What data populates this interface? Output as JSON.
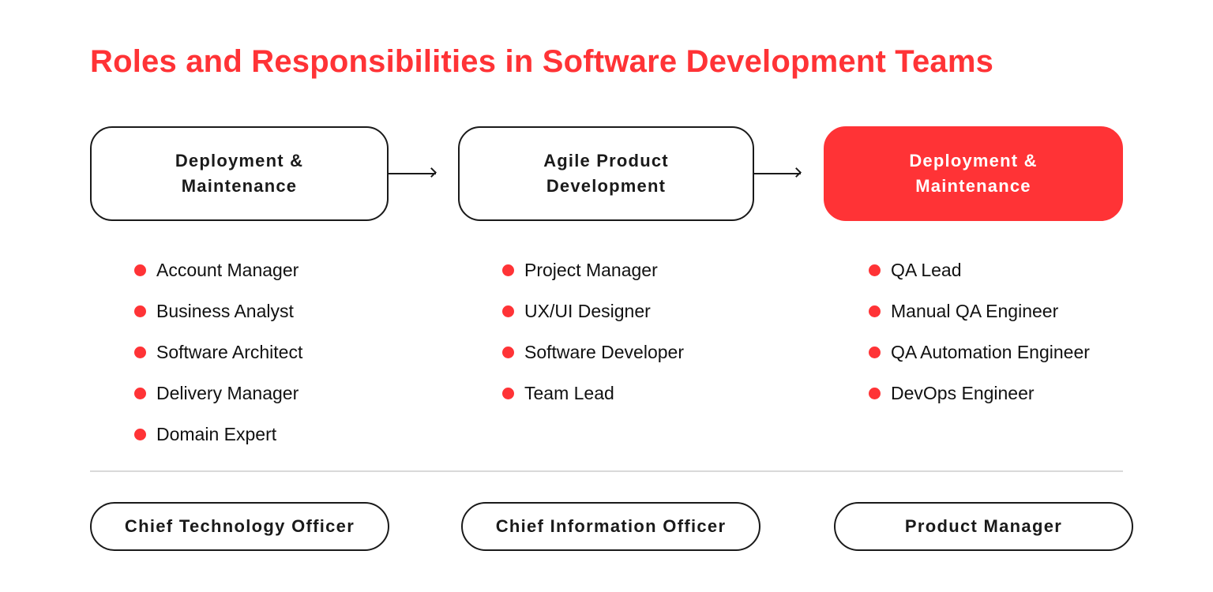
{
  "title": "Roles and Responsibilities in Software Development Teams",
  "colors": {
    "accent": "#ff3336",
    "text": "#1a1a1a",
    "divider": "#d9d9d9"
  },
  "stages": [
    {
      "line1": "Deployment &",
      "line2": "Maintenance",
      "active": false,
      "roles": [
        "Account Manager",
        "Business Analyst",
        "Software Architect",
        "Delivery Manager",
        "Domain Expert"
      ]
    },
    {
      "line1": "Agile Product",
      "line2": "Development",
      "active": false,
      "roles": [
        "Project Manager",
        "UX/UI Designer",
        "Software Developer",
        "Team Lead"
      ]
    },
    {
      "line1": "Deployment &",
      "line2": "Maintenance",
      "active": true,
      "roles": [
        "QA Lead",
        "Manual QA Engineer",
        "QA Automation Engineer",
        "DevOps Engineer"
      ]
    }
  ],
  "executives": [
    "Chief Technology Officer",
    "Chief Information Officer",
    "Product Manager"
  ]
}
